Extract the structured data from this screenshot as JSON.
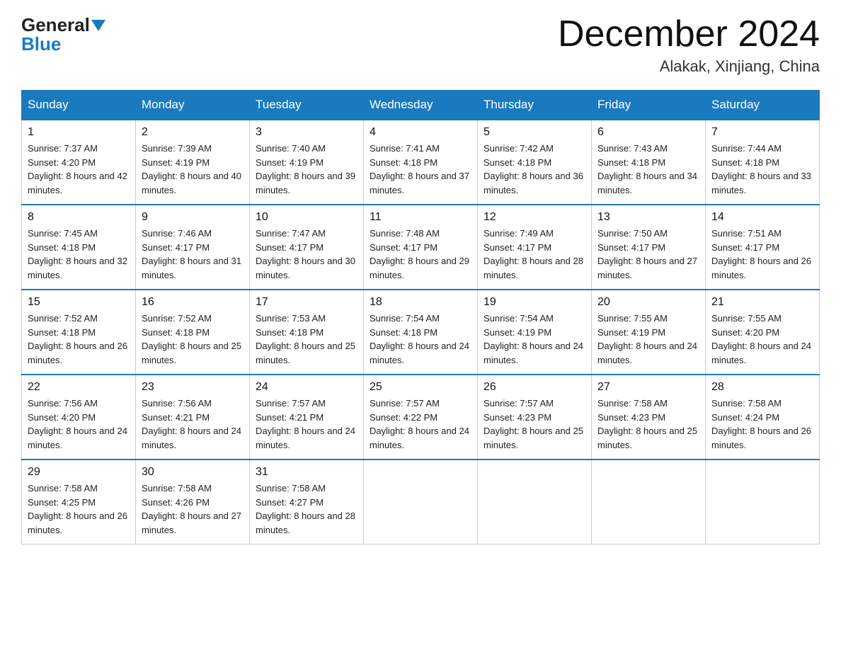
{
  "header": {
    "logo": {
      "part1": "General",
      "part2": "Blue"
    },
    "title": "December 2024",
    "location": "Alakak, Xinjiang, China"
  },
  "weekdays": [
    "Sunday",
    "Monday",
    "Tuesday",
    "Wednesday",
    "Thursday",
    "Friday",
    "Saturday"
  ],
  "weeks": [
    [
      {
        "day": "1",
        "sunrise": "7:37 AM",
        "sunset": "4:20 PM",
        "daylight": "8 hours and 42 minutes."
      },
      {
        "day": "2",
        "sunrise": "7:39 AM",
        "sunset": "4:19 PM",
        "daylight": "8 hours and 40 minutes."
      },
      {
        "day": "3",
        "sunrise": "7:40 AM",
        "sunset": "4:19 PM",
        "daylight": "8 hours and 39 minutes."
      },
      {
        "day": "4",
        "sunrise": "7:41 AM",
        "sunset": "4:18 PM",
        "daylight": "8 hours and 37 minutes."
      },
      {
        "day": "5",
        "sunrise": "7:42 AM",
        "sunset": "4:18 PM",
        "daylight": "8 hours and 36 minutes."
      },
      {
        "day": "6",
        "sunrise": "7:43 AM",
        "sunset": "4:18 PM",
        "daylight": "8 hours and 34 minutes."
      },
      {
        "day": "7",
        "sunrise": "7:44 AM",
        "sunset": "4:18 PM",
        "daylight": "8 hours and 33 minutes."
      }
    ],
    [
      {
        "day": "8",
        "sunrise": "7:45 AM",
        "sunset": "4:18 PM",
        "daylight": "8 hours and 32 minutes."
      },
      {
        "day": "9",
        "sunrise": "7:46 AM",
        "sunset": "4:17 PM",
        "daylight": "8 hours and 31 minutes."
      },
      {
        "day": "10",
        "sunrise": "7:47 AM",
        "sunset": "4:17 PM",
        "daylight": "8 hours and 30 minutes."
      },
      {
        "day": "11",
        "sunrise": "7:48 AM",
        "sunset": "4:17 PM",
        "daylight": "8 hours and 29 minutes."
      },
      {
        "day": "12",
        "sunrise": "7:49 AM",
        "sunset": "4:17 PM",
        "daylight": "8 hours and 28 minutes."
      },
      {
        "day": "13",
        "sunrise": "7:50 AM",
        "sunset": "4:17 PM",
        "daylight": "8 hours and 27 minutes."
      },
      {
        "day": "14",
        "sunrise": "7:51 AM",
        "sunset": "4:17 PM",
        "daylight": "8 hours and 26 minutes."
      }
    ],
    [
      {
        "day": "15",
        "sunrise": "7:52 AM",
        "sunset": "4:18 PM",
        "daylight": "8 hours and 26 minutes."
      },
      {
        "day": "16",
        "sunrise": "7:52 AM",
        "sunset": "4:18 PM",
        "daylight": "8 hours and 25 minutes."
      },
      {
        "day": "17",
        "sunrise": "7:53 AM",
        "sunset": "4:18 PM",
        "daylight": "8 hours and 25 minutes."
      },
      {
        "day": "18",
        "sunrise": "7:54 AM",
        "sunset": "4:18 PM",
        "daylight": "8 hours and 24 minutes."
      },
      {
        "day": "19",
        "sunrise": "7:54 AM",
        "sunset": "4:19 PM",
        "daylight": "8 hours and 24 minutes."
      },
      {
        "day": "20",
        "sunrise": "7:55 AM",
        "sunset": "4:19 PM",
        "daylight": "8 hours and 24 minutes."
      },
      {
        "day": "21",
        "sunrise": "7:55 AM",
        "sunset": "4:20 PM",
        "daylight": "8 hours and 24 minutes."
      }
    ],
    [
      {
        "day": "22",
        "sunrise": "7:56 AM",
        "sunset": "4:20 PM",
        "daylight": "8 hours and 24 minutes."
      },
      {
        "day": "23",
        "sunrise": "7:56 AM",
        "sunset": "4:21 PM",
        "daylight": "8 hours and 24 minutes."
      },
      {
        "day": "24",
        "sunrise": "7:57 AM",
        "sunset": "4:21 PM",
        "daylight": "8 hours and 24 minutes."
      },
      {
        "day": "25",
        "sunrise": "7:57 AM",
        "sunset": "4:22 PM",
        "daylight": "8 hours and 24 minutes."
      },
      {
        "day": "26",
        "sunrise": "7:57 AM",
        "sunset": "4:23 PM",
        "daylight": "8 hours and 25 minutes."
      },
      {
        "day": "27",
        "sunrise": "7:58 AM",
        "sunset": "4:23 PM",
        "daylight": "8 hours and 25 minutes."
      },
      {
        "day": "28",
        "sunrise": "7:58 AM",
        "sunset": "4:24 PM",
        "daylight": "8 hours and 26 minutes."
      }
    ],
    [
      {
        "day": "29",
        "sunrise": "7:58 AM",
        "sunset": "4:25 PM",
        "daylight": "8 hours and 26 minutes."
      },
      {
        "day": "30",
        "sunrise": "7:58 AM",
        "sunset": "4:26 PM",
        "daylight": "8 hours and 27 minutes."
      },
      {
        "day": "31",
        "sunrise": "7:58 AM",
        "sunset": "4:27 PM",
        "daylight": "8 hours and 28 minutes."
      },
      null,
      null,
      null,
      null
    ]
  ]
}
